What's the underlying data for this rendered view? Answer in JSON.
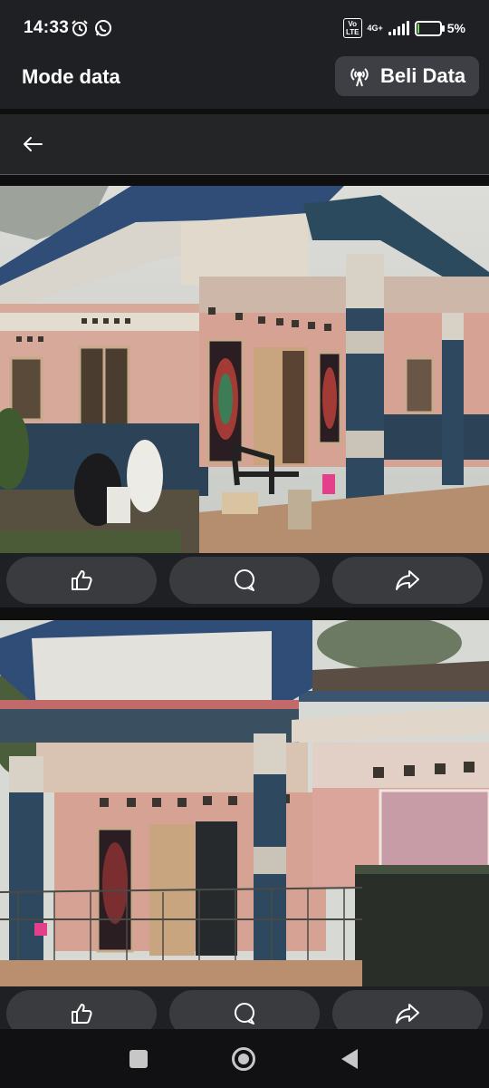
{
  "status_bar": {
    "time": "14:33",
    "left_icons": [
      "alarm-icon",
      "whatsapp-icon"
    ],
    "volte": "Vo\nLTE",
    "network": "4G+",
    "battery_percent": "5%",
    "battery_level": 0.05,
    "battery_color": "#6fdc55"
  },
  "mode_bar": {
    "title": "Mode data",
    "buy_button_label": "Beli Data",
    "buy_button_icon": "broadcast-icon"
  },
  "header": {
    "back_icon": "arrow-left-icon"
  },
  "posts": [
    {
      "image_description_icon": "house-photo",
      "actions": [
        "like-icon",
        "comment-icon",
        "share-icon"
      ]
    },
    {
      "image_description_icon": "house-photo",
      "actions": [
        "like-icon",
        "comment-icon",
        "share-icon"
      ]
    }
  ],
  "nav_bar": {
    "buttons": [
      "recents-square-icon",
      "home-circle-icon",
      "back-triangle-icon"
    ]
  },
  "colors": {
    "background": "#0f0f10",
    "bar": "#1f2023",
    "button": "#3a3b3e",
    "wall_pink": "#d4a89c",
    "wall_blue": "#2c4256"
  }
}
